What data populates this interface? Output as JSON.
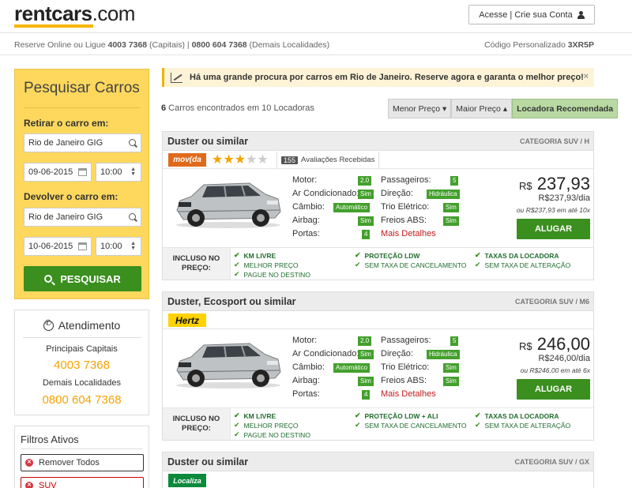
{
  "header": {
    "logo_main": "rentcars",
    "logo_tld": ".com",
    "login_label": "Acesse | Crie sua Conta"
  },
  "subheader": {
    "left_prefix": "Reserve Online ou Ligue ",
    "phone1": "4003 7368",
    "phone1_note": " (Capitais) | ",
    "phone2": "0800 604 7368",
    "phone2_note": " (Demais Localidades)",
    "code_label": "Código Personalizado ",
    "code_value": "3XR5P"
  },
  "search": {
    "title": "Pesquisar Carros",
    "pickup_label": "Retirar o carro em:",
    "pickup_location": "Rio de Janeiro GIG",
    "pickup_date": "09-06-2015",
    "pickup_time": "10:00",
    "return_label": "Devolver o carro em:",
    "return_location": "Rio de Janeiro GIG",
    "return_date": "10-06-2015",
    "return_time": "10:00",
    "button_label": "PESQUISAR"
  },
  "contact": {
    "title": "Atendimento",
    "capitals_label": "Principais Capitais",
    "capitals_phone": "4003 7368",
    "others_label": "Demais Localidades",
    "others_phone": "0800 604 7368"
  },
  "filters": {
    "title": "Filtros Ativos",
    "remove_all": "Remover Todos",
    "active": "SUV"
  },
  "alert": {
    "message": "Há uma grande procura por carros em Rio de Janeiro. Reserve agora e garanta o melhor preço!",
    "close": "×"
  },
  "results": {
    "count": "6",
    "summary": " Carros encontrados em 10 Locadoras",
    "sort": [
      "Menor Preço ▾",
      "Maior Preço ▴",
      "Locadora Recomendada"
    ]
  },
  "spec_labels": {
    "motor": "Motor:",
    "ac": "Ar Condicionado:",
    "cambio": "Câmbio:",
    "airbag": "Airbag:",
    "portas": "Portas:",
    "passageiros": "Passageiros:",
    "direcao": "Direção:",
    "trio": "Trio Elétrico:",
    "abs": "Freios ABS:",
    "more": "Mais Detalhes",
    "included": "INCLUSO NO PREÇO:",
    "rent": "ALUGAR",
    "currency": "R$"
  },
  "cars": [
    {
      "title": "Duster ou similar",
      "category": "CATEGORIA SUV / H",
      "vendor": "movida",
      "vendor_label": "mov(da",
      "reviews": "155",
      "reviews_label": "Avaliações Recebidas",
      "motor": "2.0",
      "ac": "Sim",
      "cambio": "Automático",
      "airbag": "Sim",
      "portas": "4",
      "passageiros": "5",
      "direcao": "Hidráulica",
      "trio": "Sim",
      "abs": "Sim",
      "price": "237,93",
      "price_day": "R$237,93/dia",
      "installments": "ou R$237,93 em até 10x",
      "included": [
        "KM LIVRE",
        "PROTEÇÃO LDW",
        "TAXAS DA LOCADORA",
        "MELHOR PREÇO",
        "SEM TAXA DE CANCELAMENTO",
        "SEM TAXA DE ALTERAÇÃO",
        "PAGUE NO DESTINO"
      ]
    },
    {
      "title": "Duster, Ecosport ou similar",
      "category": "CATEGORIA SUV / M6",
      "vendor": "hertz",
      "vendor_label": "Hertz",
      "motor": "2.0",
      "ac": "Sim",
      "cambio": "Automático",
      "airbag": "Sim",
      "portas": "4",
      "passageiros": "5",
      "direcao": "Hidráulica",
      "trio": "Sim",
      "abs": "Sim",
      "price": "246,00",
      "price_day": "R$246,00/dia",
      "installments": "ou R$246,00 em até 6x",
      "included": [
        "KM LIVRE",
        "PROTEÇÃO LDW + ALI",
        "TAXAS DA LOCADORA",
        "MELHOR PREÇO",
        "SEM TAXA DE CANCELAMENTO",
        "SEM TAXA DE ALTERAÇÃO",
        "PAGUE NO DESTINO"
      ]
    },
    {
      "title": "Duster ou similar",
      "category": "CATEGORIA SUV / GX",
      "vendor": "localiza",
      "vendor_label": "Localiza"
    }
  ],
  "colors": {
    "accent_yellow": "#fdd85d",
    "brand_green": "#3a8f1e",
    "phone_orange": "#f5a300",
    "detail_red": "#c41a1a"
  }
}
